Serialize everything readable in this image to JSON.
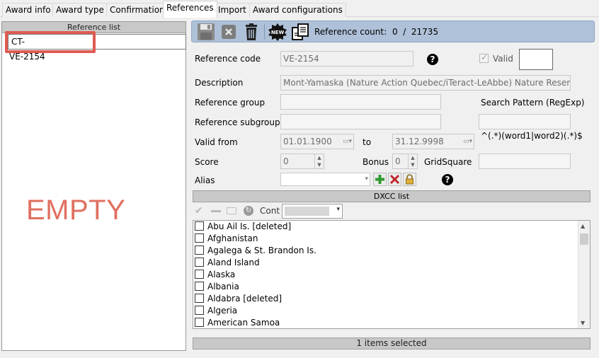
{
  "tabs": [
    "Award info",
    "Award type",
    "Confirmation",
    "References",
    "Import",
    "Award configurations"
  ],
  "left": {
    "header": "Reference list",
    "filter_value": "CT-",
    "items": [
      "VE-2154"
    ],
    "annotation": "EMPTY"
  },
  "toolbar": {
    "ref_count_label": "Reference count:",
    "ref_count_value": "0  /  21735",
    "new_badge": "NEW"
  },
  "form": {
    "reference_code_label": "Reference code",
    "reference_code_value": "VE-2154",
    "valid_label": "Valid",
    "description_label": "Description",
    "description_value": "Mont-Yamaska (Nature Action Quebec/iTeract-LeAbbe)  Nature Reserve",
    "reference_group_label": "Reference group",
    "reference_subgroup_label": "Reference subgroup",
    "search_pattern_label": "Search Pattern (RegExp)",
    "search_pattern_hint": "^(.*)(word1|word2)(.*)$",
    "valid_from_label": "Valid from",
    "valid_from_value": "01.01.1900",
    "to_label": "to",
    "valid_to_value": "31.12.9998",
    "score_label": "Score",
    "score_value": "0",
    "bonus_label": "Bonus",
    "bonus_value": "0",
    "gridsquare_label": "GridSquare",
    "alias_label": "Alias"
  },
  "dxcc": {
    "header": "DXCC list",
    "cont_label": "Cont",
    "items": [
      "Abu Ail Is. [deleted]",
      "Afghanistan",
      "Agalega & St. Brandon Is.",
      "Aland Island",
      "Alaska",
      "Albania",
      "Aldabra [deleted]",
      "Algeria",
      "American Samoa"
    ]
  },
  "status": "1 items selected"
}
